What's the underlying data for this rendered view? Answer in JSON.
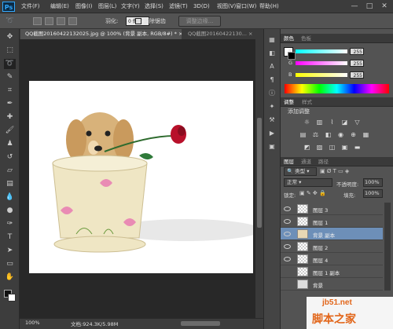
{
  "app": {
    "logo": "Ps"
  },
  "menu": [
    "文件(F)",
    "编辑(E)",
    "图像(I)",
    "图层(L)",
    "文字(Y)",
    "选择(S)",
    "滤镜(T)",
    "3D(D)",
    "视图(V)",
    "窗口(W)",
    "帮助(H)"
  ],
  "window_controls": [
    "—",
    "□",
    "✕"
  ],
  "options": {
    "feather_label": "羽化:",
    "feather_value": "0 像素",
    "antialias_label": "消除锯齿",
    "refine_edge_label": "调整边缘..."
  },
  "tabs": [
    {
      "label": "QQ截图20160422132025.jpg @ 100% (背景 副本, RGB/8#) *",
      "close": "×"
    },
    {
      "label": "QQ截图20160422130...",
      "close": "×"
    }
  ],
  "status": {
    "zoom": "100%",
    "doc": "文档:924.3K/5.98M"
  },
  "color_panel": {
    "tabs": [
      "颜色",
      "色板"
    ],
    "channels": [
      {
        "label": "R",
        "value": "255",
        "color": "#ff0000"
      },
      {
        "label": "G",
        "value": "255",
        "color": "#00ff00"
      },
      {
        "label": "B",
        "value": "255",
        "color": "#0000ff"
      }
    ]
  },
  "adjust_panel": {
    "tabs": [
      "调整",
      "样式"
    ],
    "title": "添加调整"
  },
  "layers_panel": {
    "tabs": [
      "图层",
      "通道",
      "路径"
    ],
    "filter": "类型",
    "blend_mode": "正常",
    "opacity_label": "不透明度:",
    "opacity_value": "100%",
    "lock_label": "锁定:",
    "fill_label": "填充:",
    "fill_value": "100%",
    "layers": [
      {
        "name": "图层 3",
        "visible": true,
        "selected": false
      },
      {
        "name": "图层 1",
        "visible": true,
        "selected": false
      },
      {
        "name": "背景 副本",
        "visible": true,
        "selected": true
      },
      {
        "name": "图层 2",
        "visible": true,
        "selected": false
      },
      {
        "name": "图层 4",
        "visible": true,
        "selected": false
      },
      {
        "name": "图层 1 副本",
        "visible": false,
        "selected": false
      },
      {
        "name": "背景",
        "visible": false,
        "selected": false
      }
    ]
  },
  "watermark": {
    "url": "jb51.net",
    "site": "脚本之家"
  }
}
